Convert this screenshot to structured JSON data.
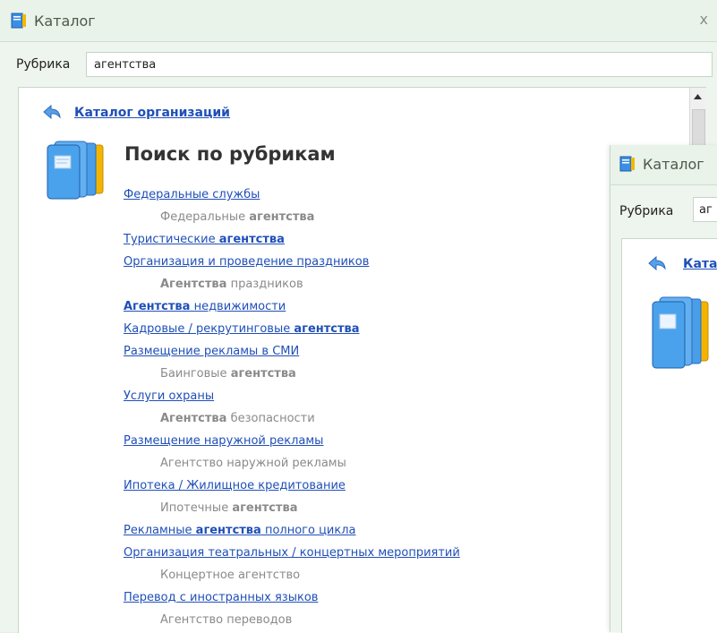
{
  "window": {
    "title": "Каталог",
    "close_label": "x"
  },
  "search": {
    "label": "Рубрика",
    "value": "агентства"
  },
  "breadcrumb": {
    "link": "Каталог организаций"
  },
  "heading": "Поиск по рубрикам",
  "results": [
    {
      "type": "category",
      "parts": [
        {
          "t": "Федеральные службы",
          "b": false
        }
      ]
    },
    {
      "type": "sub",
      "parts": [
        {
          "t": "Федеральные ",
          "b": false
        },
        {
          "t": "агентства",
          "b": true
        }
      ]
    },
    {
      "type": "category",
      "parts": [
        {
          "t": "Туристические ",
          "b": false
        },
        {
          "t": "агентства",
          "b": true
        }
      ]
    },
    {
      "type": "category",
      "parts": [
        {
          "t": "Организация и проведение праздников",
          "b": false
        }
      ]
    },
    {
      "type": "sub",
      "parts": [
        {
          "t": "Агентства",
          "b": true
        },
        {
          "t": " праздников",
          "b": false
        }
      ]
    },
    {
      "type": "category",
      "parts": [
        {
          "t": "Агентства",
          "b": true
        },
        {
          "t": " недвижимости",
          "b": false
        }
      ]
    },
    {
      "type": "category",
      "parts": [
        {
          "t": "Кадровые / рекрутинговые ",
          "b": false
        },
        {
          "t": "агентства",
          "b": true
        }
      ]
    },
    {
      "type": "category",
      "parts": [
        {
          "t": "Размещение рекламы в СМИ",
          "b": false
        }
      ]
    },
    {
      "type": "sub",
      "parts": [
        {
          "t": "Баинговые ",
          "b": false
        },
        {
          "t": "агентства",
          "b": true
        }
      ]
    },
    {
      "type": "category",
      "parts": [
        {
          "t": "Услуги охраны",
          "b": false
        }
      ]
    },
    {
      "type": "sub",
      "parts": [
        {
          "t": "Агентства",
          "b": true
        },
        {
          "t": " безопасности",
          "b": false
        }
      ]
    },
    {
      "type": "category",
      "parts": [
        {
          "t": "Размещение наружной рекламы",
          "b": false
        }
      ]
    },
    {
      "type": "sub",
      "parts": [
        {
          "t": "Агентство наружной рекламы",
          "b": false
        }
      ]
    },
    {
      "type": "category",
      "parts": [
        {
          "t": "Ипотека / Жилищное кредитование",
          "b": false
        }
      ]
    },
    {
      "type": "sub",
      "parts": [
        {
          "t": "Ипотечные ",
          "b": false
        },
        {
          "t": "агентства",
          "b": true
        }
      ]
    },
    {
      "type": "category",
      "parts": [
        {
          "t": "Рекламные ",
          "b": false
        },
        {
          "t": "агентства",
          "b": true
        },
        {
          "t": " полного цикла",
          "b": false
        }
      ]
    },
    {
      "type": "category",
      "parts": [
        {
          "t": "Организация театральных / концертных мероприятий",
          "b": false
        }
      ]
    },
    {
      "type": "sub",
      "parts": [
        {
          "t": "Концертное агентство",
          "b": false
        }
      ]
    },
    {
      "type": "category",
      "parts": [
        {
          "t": "Перевод с иностранных языков",
          "b": false
        }
      ]
    },
    {
      "type": "sub",
      "parts": [
        {
          "t": "Агентство переводов",
          "b": false
        }
      ]
    }
  ],
  "second_window": {
    "title": "Каталог",
    "search_label": "Рубрика",
    "search_value": "аг",
    "breadcrumb_link": "Ката"
  },
  "colors": {
    "link": "#1f4fb8",
    "sub": "#8a8a8a",
    "background": "#eef5ee"
  },
  "icons": [
    "catalog-app-icon",
    "back-arrow-icon",
    "folder-icon",
    "scroll-up-icon",
    "close-icon"
  ]
}
